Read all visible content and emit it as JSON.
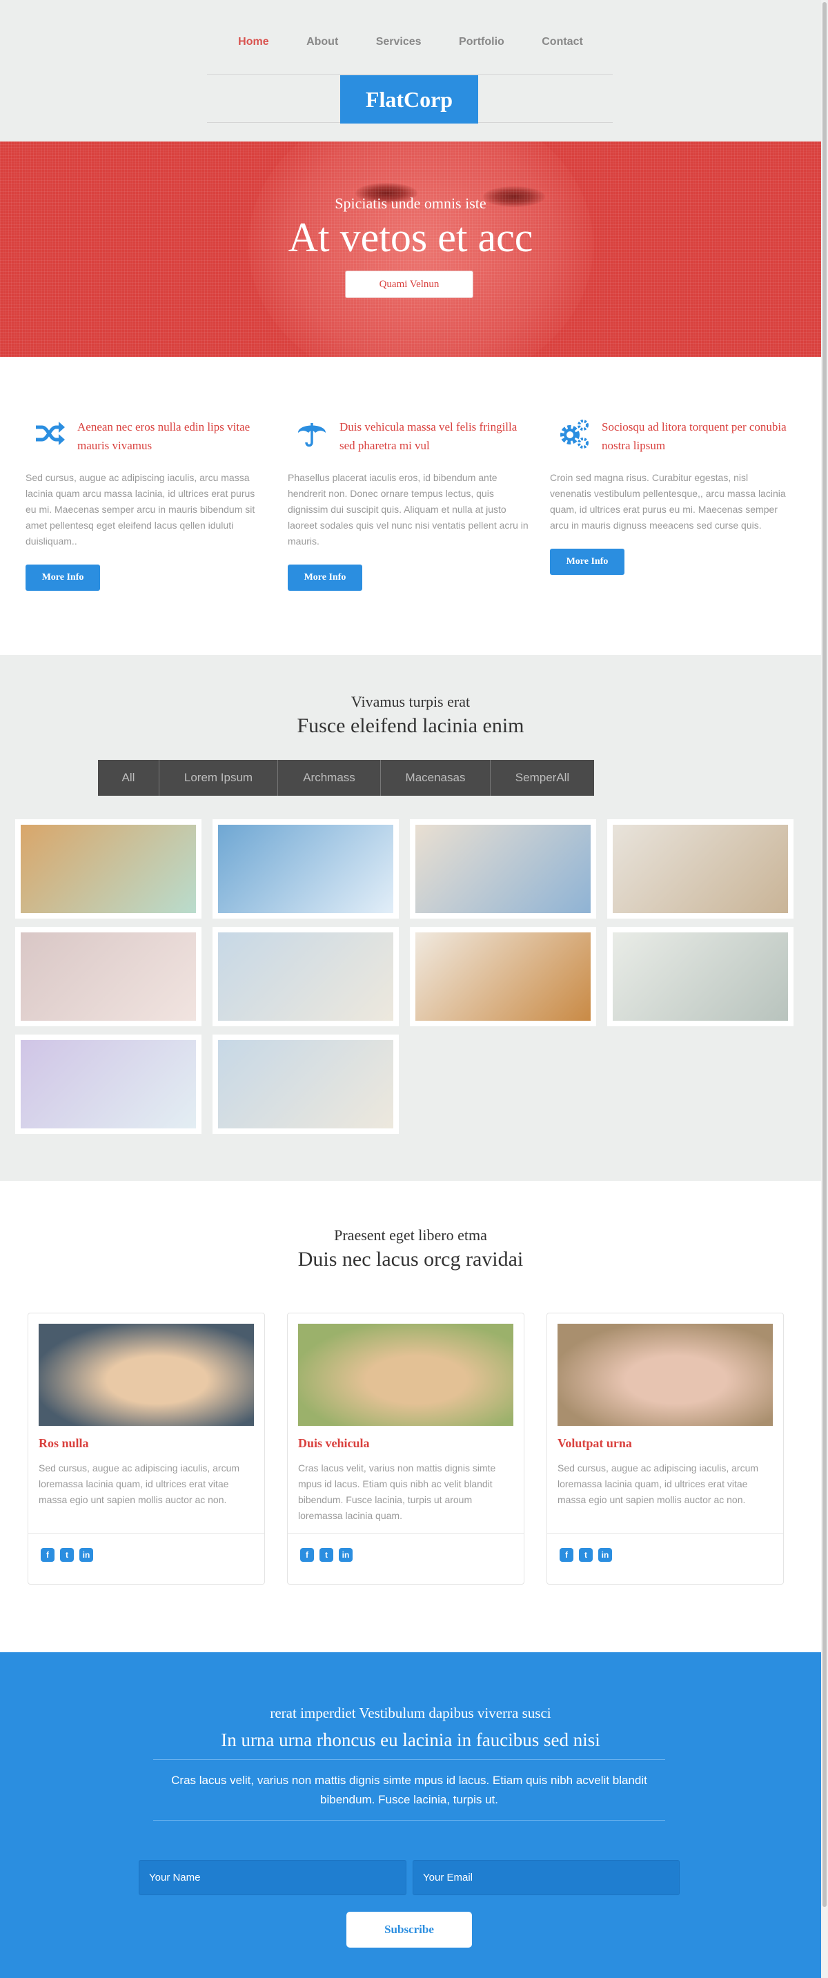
{
  "nav": {
    "items": [
      {
        "label": "Home",
        "active": true
      },
      {
        "label": "About",
        "active": false
      },
      {
        "label": "Services",
        "active": false
      },
      {
        "label": "Portfolio",
        "active": false
      },
      {
        "label": "Contact",
        "active": false
      }
    ]
  },
  "brand": {
    "name": "FlatCorp"
  },
  "hero": {
    "subtitle": "Spiciatis unde omnis iste",
    "title": "At vetos et acc",
    "button": "Quami Velnun"
  },
  "features": [
    {
      "icon": "shuffle-icon",
      "title": "Aenean nec eros nulla edin lips vitae mauris vivamus",
      "text": "Sed cursus, augue ac adipiscing iaculis, arcu massa lacinia quam arcu massa lacinia, id ultrices erat purus eu mi. Maecenas semper arcu in mauris bibendum sit amet pellentesq eget eleifend lacus qellen iduluti duisliquam..",
      "button": "More Info"
    },
    {
      "icon": "umbrella-icon",
      "title": "Duis vehicula massa vel felis fringilla sed pharetra mi vul",
      "text": "Phasellus placerat iaculis eros, id bibendum ante hendrerit non. Donec ornare tempus lectus, quis dignissim dui suscipit quis. Aliquam et nulla at justo laoreet sodales quis vel nunc nisi ventatis pellent acru in mauris.",
      "button": "More Info"
    },
    {
      "icon": "gears-icon",
      "title": "Sociosqu ad litora torquent per conubia nostra lipsum",
      "text": "Croin sed magna risus. Curabitur egestas, nisl venenatis vestibulum pellentesque,, arcu massa lacinia quam, id ultrices erat purus eu mi. Maecenas semper arcu in mauris dignuss meeacens sed curse quis.",
      "button": "More Info"
    }
  ],
  "portfolio": {
    "subtitle": "Vivamus turpis erat",
    "title": "Fusce eleifend lacinia enim",
    "filters": [
      "All",
      "Lorem Ipsum",
      "Archmass",
      "Macenasas",
      "SemperAll"
    ],
    "items": [
      {
        "image": "muffins-coffee-photo",
        "colors": [
          "#d9a66a",
          "#b9dccd"
        ]
      },
      {
        "image": "blue-pillows-photo",
        "colors": [
          "#6fa7d3",
          "#e2eef8"
        ]
      },
      {
        "image": "chair-towels-photo",
        "colors": [
          "#e9dfd2",
          "#8fb3d4"
        ]
      },
      {
        "image": "teapot-bowls-photo",
        "colors": [
          "#e8e3db",
          "#c9b497"
        ]
      },
      {
        "image": "candles-photo",
        "colors": [
          "#d9c7c6",
          "#f1e4e0"
        ]
      },
      {
        "image": "folded-towels-photo",
        "colors": [
          "#c7d8e6",
          "#ede8dd"
        ]
      },
      {
        "image": "croissant-tea-photo",
        "colors": [
          "#f0e9df",
          "#c98a45"
        ]
      },
      {
        "image": "alarm-clock-photo",
        "colors": [
          "#e9ece7",
          "#b8c3bd"
        ]
      },
      {
        "image": "soap-lavender-photo",
        "colors": [
          "#d0c5e6",
          "#e3eef3"
        ]
      },
      {
        "image": "folded-towels-2-photo",
        "colors": [
          "#c7d8e6",
          "#ede8dd"
        ]
      }
    ]
  },
  "team": {
    "subtitle": "Praesent eget libero etma",
    "title": "Duis nec lacus orcg ravidai",
    "members": [
      {
        "name": "Ros nulla",
        "bio": "Sed cursus, augue ac adipiscing iaculis, arcum loremassa lacinia quam, id ultrices erat vitae massa egio unt sapien mollis auctor ac non.",
        "photo": "blonde-woman-photo",
        "colors": [
          "#4a5c6c",
          "#e9c9a6"
        ]
      },
      {
        "name": "Duis vehicula",
        "bio": "Cras lacus velit, varius non mattis dignis simte mpus id lacus. Etiam quis nibh ac velit blandit bibendum. Fusce lacinia, turpis ut aroum loremassa lacinia quam.",
        "photo": "blonde-woman-outdoor-photo",
        "colors": [
          "#9bb16b",
          "#e3c195"
        ]
      },
      {
        "name": "Volutpat urna",
        "bio": "Sed cursus, augue ac adipiscing iaculis, arcum loremassa lacinia quam, id ultrices erat vitae massa egio unt sapien mollis auctor ac non.",
        "photo": "woman-straw-hat-photo",
        "colors": [
          "#a98f6e",
          "#e7c4b1"
        ]
      }
    ],
    "socials": [
      "f",
      "t",
      "in"
    ]
  },
  "subscribe": {
    "subtitle": "rerat imperdiet Vestibulum dapibus viverra susci",
    "title": "In urna urna rhoncus eu lacinia in faucibus sed nisi",
    "text": "Cras lacus velit, varius non mattis dignis simte mpus id lacus. Etiam quis nibh acvelit blandit bibendum. Fusce lacinia, turpis ut.",
    "name_placeholder": "Your Name",
    "email_placeholder": "Your Email",
    "button": "Subscribe"
  },
  "colors": {
    "accent_red": "#d9413e",
    "accent_blue": "#2b8ee0",
    "page_bg": "#eceeed"
  }
}
